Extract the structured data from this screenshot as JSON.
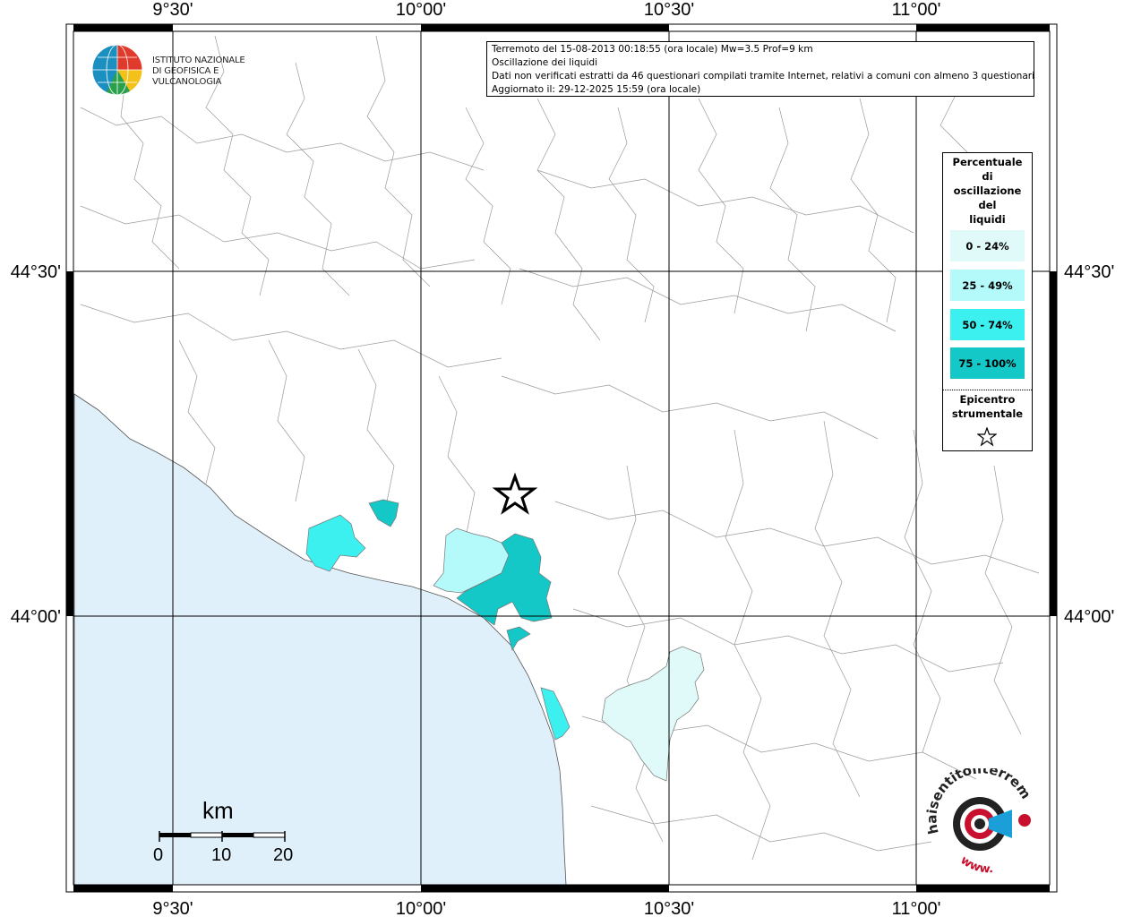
{
  "info": {
    "line1": "Terremoto del 15-08-2013 00:18:55 (ora locale) Mw=3.5 Prof=9 km",
    "line2": "Oscillazione dei liquidi",
    "line3": "Dati non verificati estratti da 46 questionari compilati tramite Internet, relativi a comuni con almeno 3 questionari.",
    "line4": "Aggiornato il: 29-12-2025 15:59 (ora locale)"
  },
  "ingv_logo": {
    "line1": "ISTITUTO NAZIONALE",
    "line2": "DI GEOFISICA E VULCANOLOGIA"
  },
  "axes": {
    "longitude_ticks": [
      "9°30'",
      "10°00'",
      "10°30'",
      "11°00'"
    ],
    "latitude_ticks": [
      "44°30'",
      "44°00'"
    ]
  },
  "legend": {
    "title_lines": [
      "Percentuale",
      "di",
      "oscillazione",
      "del",
      "liquidi"
    ],
    "classes": [
      {
        "label": "0 - 24%",
        "color": "#e0fafa"
      },
      {
        "label": "25 - 49%",
        "color": "#b4fafa"
      },
      {
        "label": "50 - 74%",
        "color": "#3cf0f0"
      },
      {
        "label": "75 - 100%",
        "color": "#14c8c8"
      }
    ],
    "epicenter_lines": [
      "Epicentro",
      "strumentale"
    ],
    "star_icon": "star-outline-icon"
  },
  "scale_bar": {
    "unit": "km",
    "labels": [
      "0",
      "10",
      "20"
    ]
  },
  "badge": {
    "text_arc": "haisentitoilterremoto.it",
    "text_www": "www.",
    "icon": "megaphone-icon"
  },
  "colors": {
    "sea": "#e0f0fa",
    "border": "#000000",
    "grid": "#000000",
    "boundaries": "#9a9a9a"
  }
}
